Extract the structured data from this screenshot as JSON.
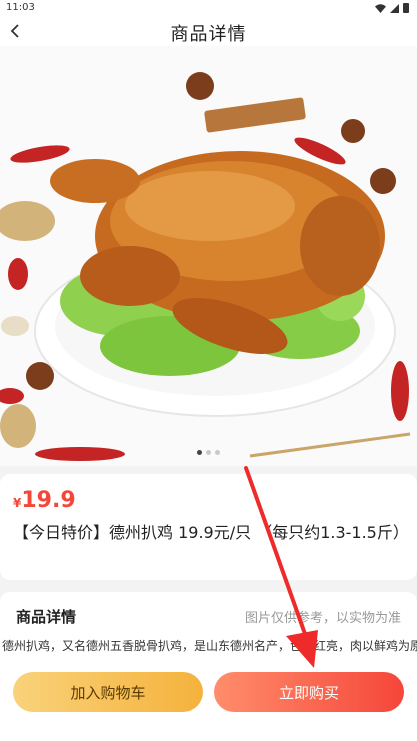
{
  "status_bar": {
    "time": "11:03"
  },
  "nav": {
    "title": "商品详情",
    "back_icon": "chevron-left-icon"
  },
  "carousel": {
    "slides": 3,
    "active": 1
  },
  "product": {
    "price_symbol": "¥",
    "price": "19.9",
    "title": "【今日特价】德州扒鸡 19.9元/只 （每只约1.3-1.5斤）"
  },
  "detail": {
    "heading": "商品详情",
    "note": "图片仅供参考，以实物为准",
    "body": "德州扒鸡，又名德州五香脱骨扒鸡，是山东德州名产，色泽红亮，肉以鲜鸡为原料，经"
  },
  "actions": {
    "cart_label": "加入购物车",
    "buy_label": "立即购买"
  },
  "colors": {
    "price": "#f5463a",
    "buy": "#f5463a",
    "cart": "#f5b23c",
    "arrow": "#ee2a2a"
  }
}
